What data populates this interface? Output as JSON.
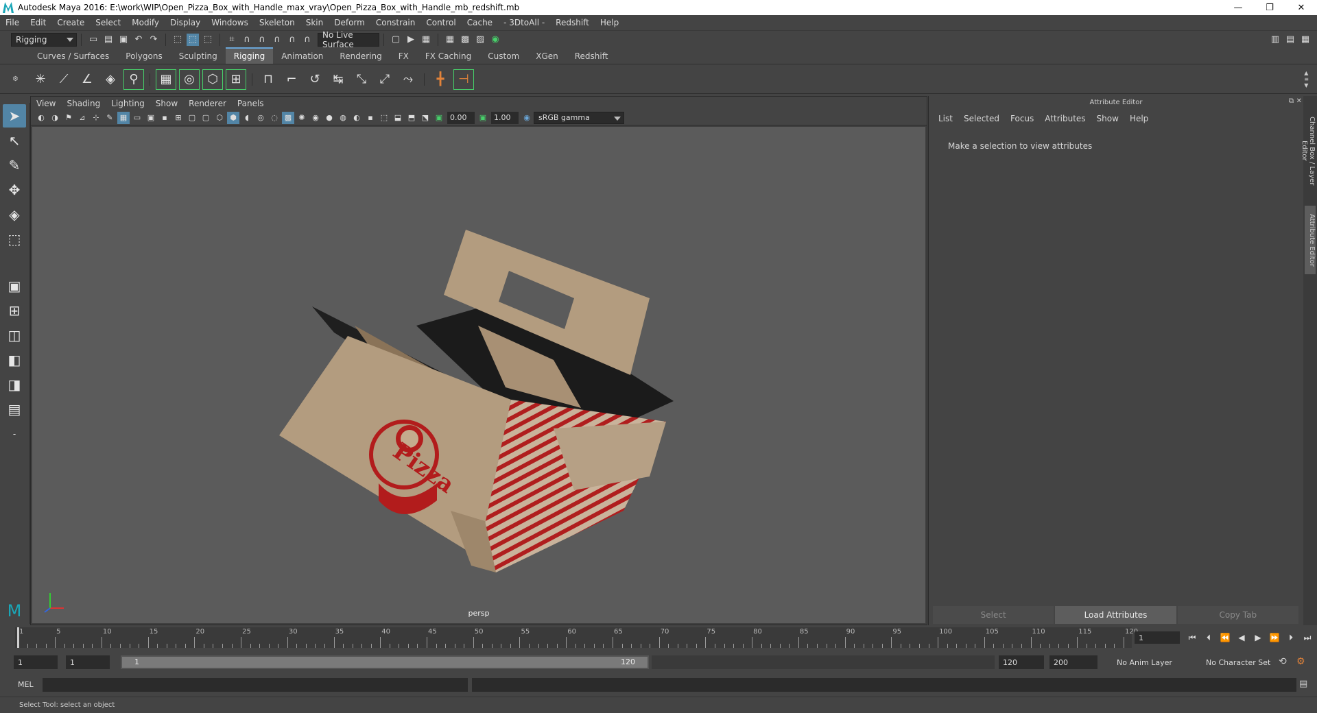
{
  "window": {
    "title": "Autodesk Maya 2016: E:\\work\\WIP\\Open_Pizza_Box_with_Handle_max_vray\\Open_Pizza_Box_with_Handle_mb_redshift.mb",
    "minimize": "—",
    "restore": "❐",
    "close": "✕"
  },
  "menubar": [
    "File",
    "Edit",
    "Create",
    "Select",
    "Modify",
    "Display",
    "Windows",
    "Skeleton",
    "Skin",
    "Deform",
    "Constrain",
    "Control",
    "Cache",
    "- 3DtoAll -",
    "Redshift",
    "Help"
  ],
  "statusline": {
    "menu_set": "Rigging",
    "live_surface": "No Live Surface"
  },
  "shelf": {
    "tabs": [
      "Curves / Surfaces",
      "Polygons",
      "Sculpting",
      "Rigging",
      "Animation",
      "Rendering",
      "FX",
      "FX Caching",
      "Custom",
      "XGen",
      "Redshift"
    ],
    "active_tab": "Rigging"
  },
  "viewport": {
    "menu": [
      "View",
      "Shading",
      "Lighting",
      "Show",
      "Renderer",
      "Panels"
    ],
    "exposure": "0.00",
    "gamma": "1.00",
    "color_space": "sRGB gamma",
    "camera_label": "persp",
    "model_text": "Pizza"
  },
  "attribute_editor": {
    "title": "Attribute Editor",
    "menu": [
      "List",
      "Selected",
      "Focus",
      "Attributes",
      "Show",
      "Help"
    ],
    "message": "Make a selection to view attributes",
    "buttons": [
      "Select",
      "Load Attributes",
      "Copy Tab"
    ]
  },
  "side_tabs": [
    "Channel Box / Layer Editor",
    "Attribute Editor"
  ],
  "timeline": {
    "tick_labels": [
      "1",
      "5",
      "10",
      "15",
      "20",
      "25",
      "30",
      "35",
      "40",
      "45",
      "50",
      "55",
      "60",
      "65",
      "70",
      "75",
      "80",
      "85",
      "90",
      "95",
      "100",
      "105",
      "110",
      "115",
      "120"
    ],
    "current_frame": "1"
  },
  "range": {
    "start": "1",
    "playback_start": "1",
    "range_start_label": "1",
    "range_end_label": "120",
    "playback_end": "120",
    "end": "200",
    "anim_layer": "No Anim Layer",
    "character_set": "No Character Set"
  },
  "command_line": {
    "label": "MEL"
  },
  "help_line": "Select Tool: select an object",
  "colors": {
    "accent": "#5285a6",
    "pizza_red": "#b21c1c",
    "cardboard": "#b39c7f"
  }
}
